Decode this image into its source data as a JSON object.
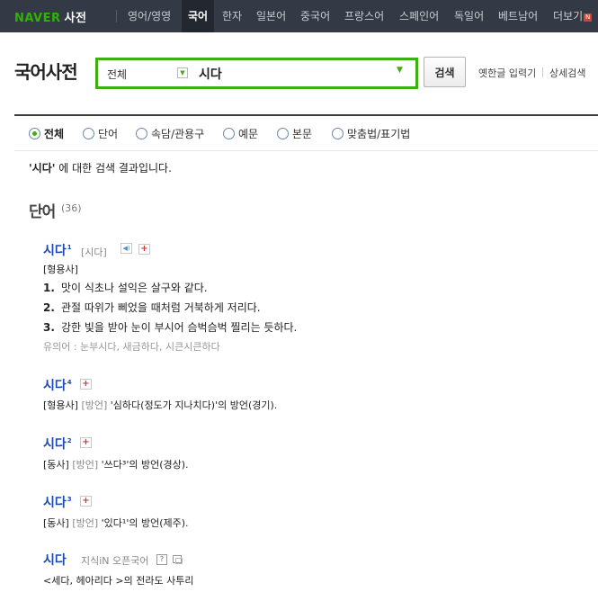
{
  "nav": {
    "logo": "NAVER",
    "logo_dict": "사전",
    "tabs": [
      "영어/영영",
      "국어",
      "한자",
      "일본어",
      "중국어",
      "프랑스어",
      "스페인어",
      "독일어",
      "베트남어",
      "더보기"
    ],
    "active_tab": "국어",
    "more_badge": "N"
  },
  "header": {
    "title": "국어사전",
    "scope": "전체",
    "query": "시다",
    "search_button": "검색",
    "links": [
      "옛한글 입력기",
      "상세검색"
    ]
  },
  "filters": {
    "items": [
      "전체",
      "단어",
      "속담/관용구",
      "예문",
      "본문",
      "맞춤법/표기법"
    ],
    "selected": "전체"
  },
  "summary": {
    "term": "'시다'",
    "text": " 에 대한 검색 결과입니다."
  },
  "section": {
    "title": "단어",
    "count": "(36)"
  },
  "entries": [
    {
      "headword": "시다",
      "sup": "1",
      "pron": "[시다]",
      "pos": "[형용사]",
      "senses": [
        {
          "num": "1.",
          "text": "맛이 식초나 설익은 살구와 같다."
        },
        {
          "num": "2.",
          "text": "관절 따위가 삐었을 때처럼 거북하게 저리다."
        },
        {
          "num": "3.",
          "text": "강한 빛을 받아 눈이 부시어 슴벅슴벅 찔리는 듯하다."
        }
      ],
      "synonyms": "유의어 : 눈부시다, 새금하다, 시큰시큰하다"
    },
    {
      "headword": "시다",
      "sup": "4",
      "pos": "[형용사]",
      "tag": "[방언]",
      "def": "'심하다(정도가 지나치다)'의 방언(경기)."
    },
    {
      "headword": "시다",
      "sup": "2",
      "pos": "[동사]",
      "tag": "[방언]",
      "def": "'쓰다³'의 방언(경상)."
    },
    {
      "headword": "시다",
      "sup": "3",
      "pos": "[동사]",
      "tag": "[방언]",
      "def": "'있다¹'의 방언(제주)."
    },
    {
      "headword": "시다",
      "source": "지식iN 오픈국어",
      "def": "<세다, 헤아리다 >의 전라도 사투리"
    }
  ]
}
